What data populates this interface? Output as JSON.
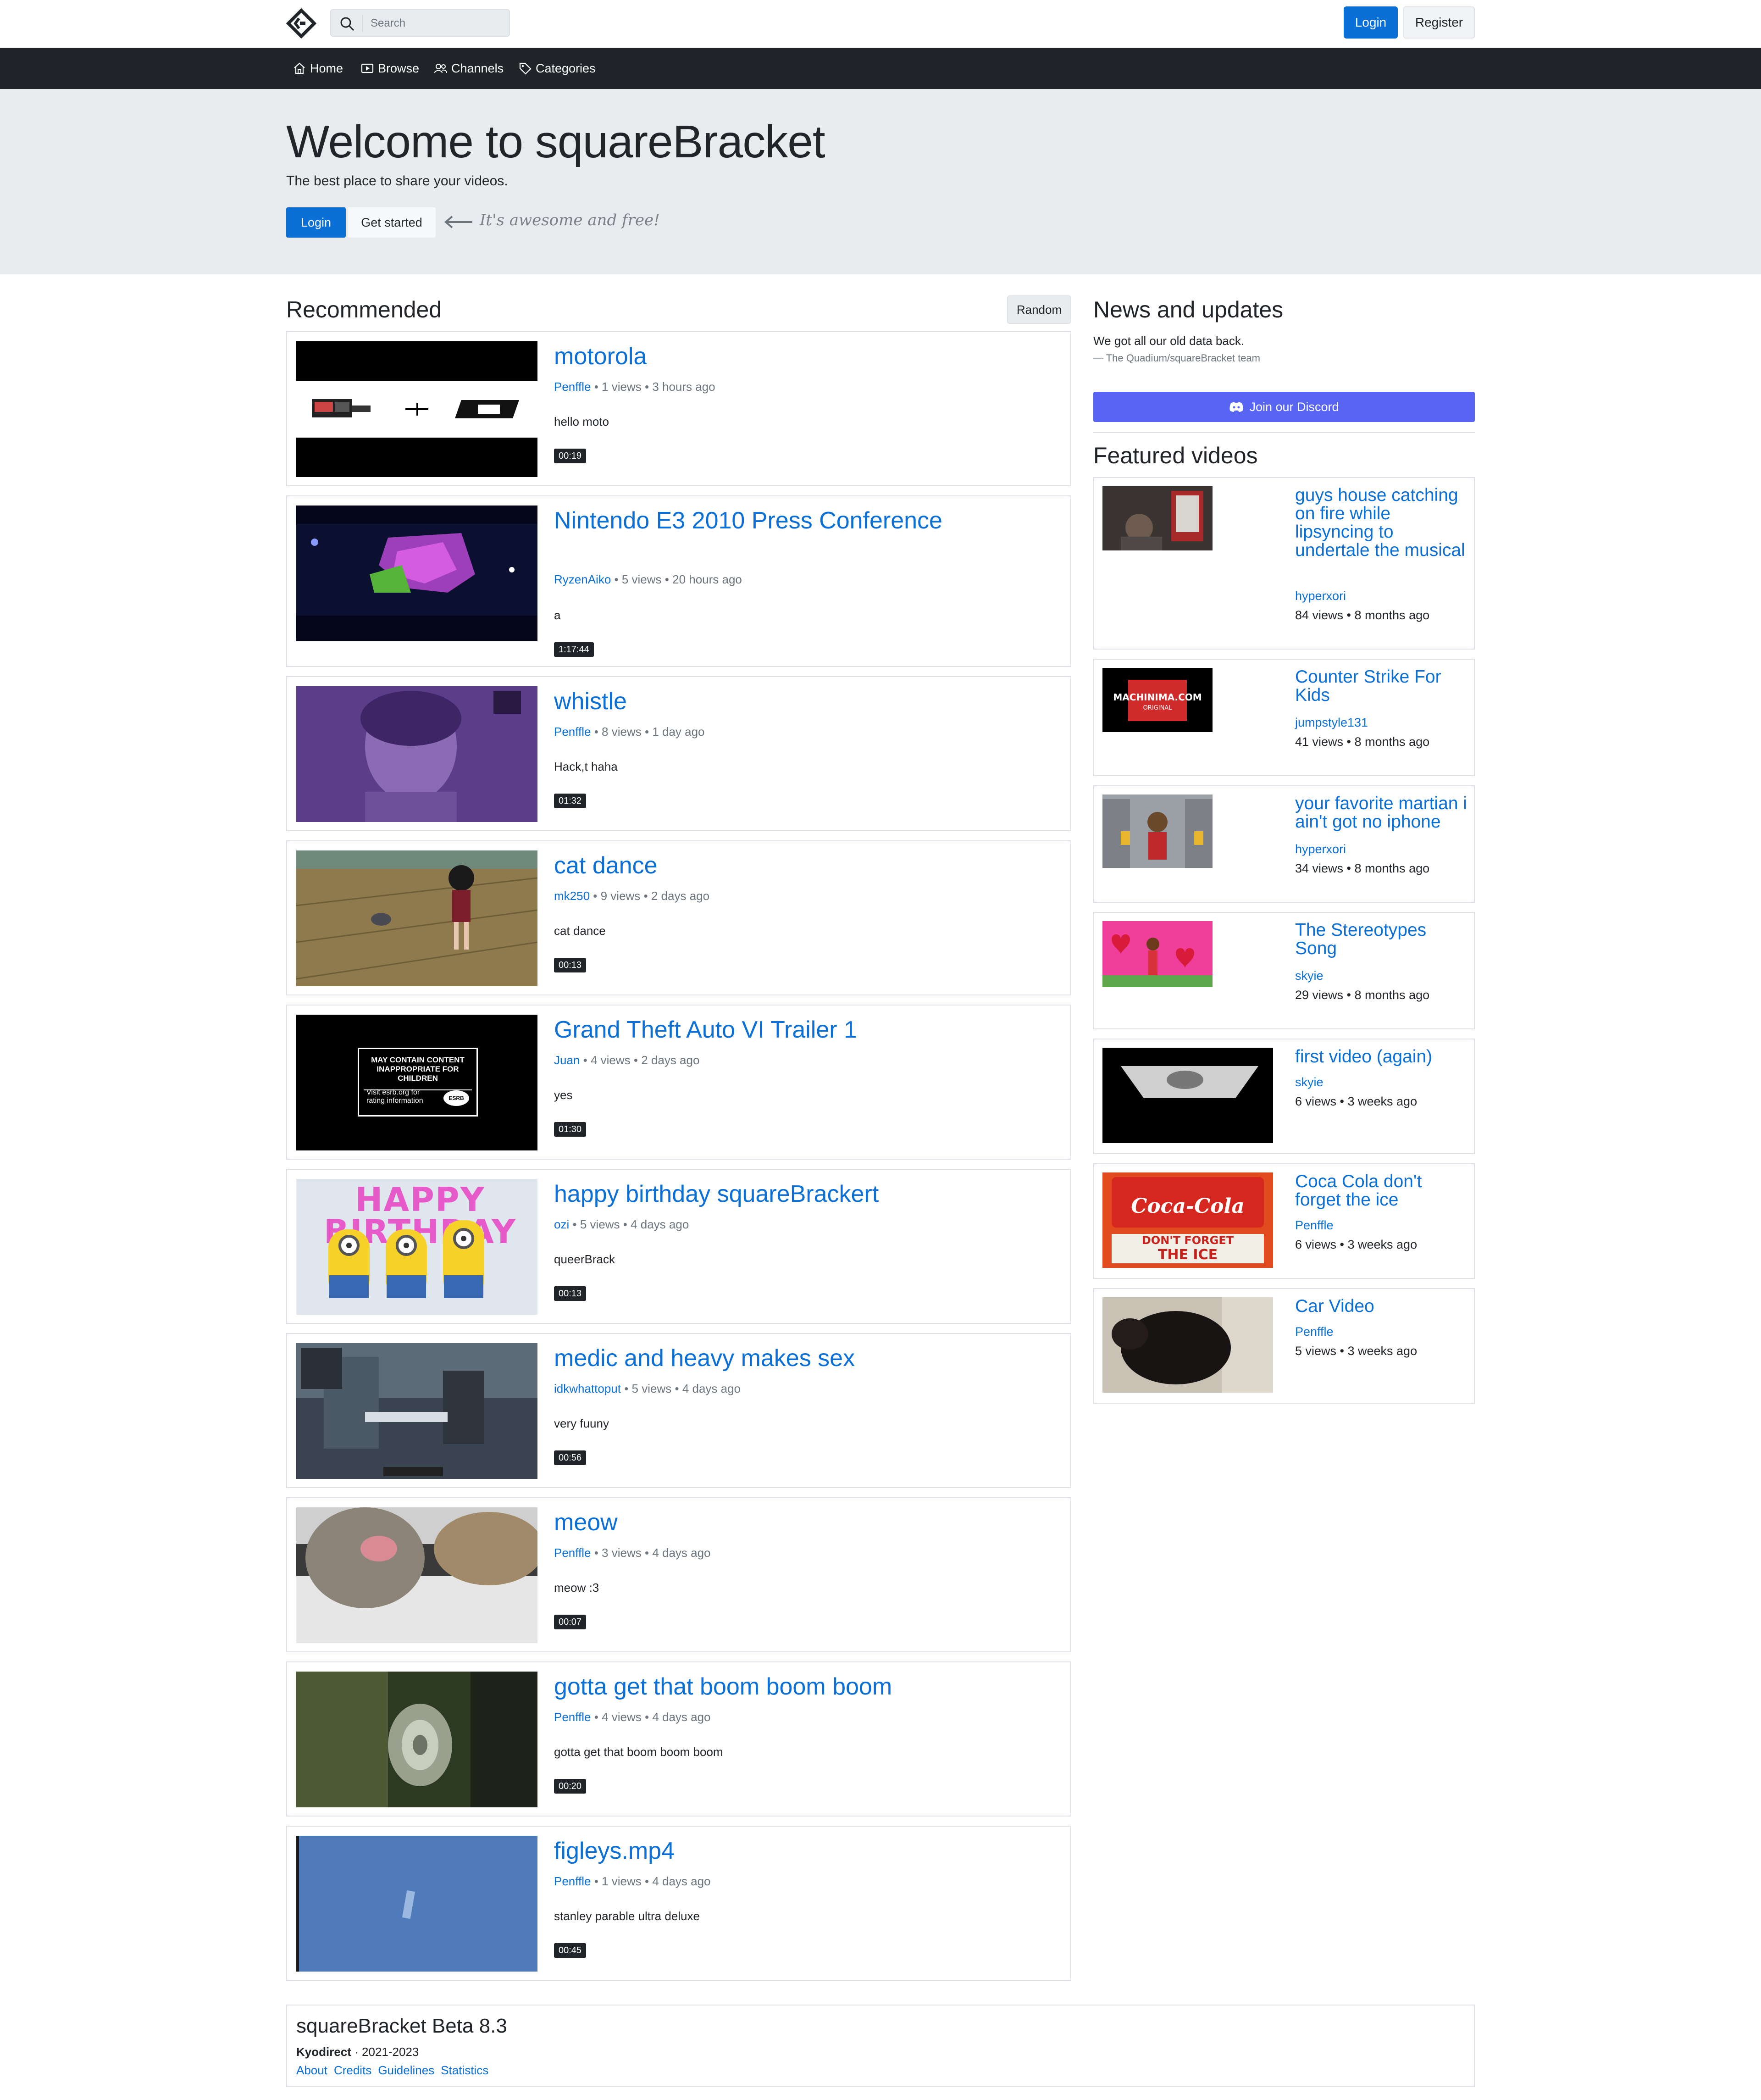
{
  "header": {
    "search_placeholder": "Search",
    "login_label": "Login",
    "register_label": "Register"
  },
  "nav": {
    "items": [
      {
        "label": "Home",
        "icon": "home-icon"
      },
      {
        "label": "Browse",
        "icon": "play-icon"
      },
      {
        "label": "Channels",
        "icon": "users-icon"
      },
      {
        "label": "Categories",
        "icon": "tag-icon"
      }
    ]
  },
  "hero": {
    "title": "Welcome to squareBracket",
    "lead": "The best place to share your videos.",
    "login_label": "Login",
    "start_label": "Get started",
    "tagline": "It's awesome and free!"
  },
  "recommended": {
    "title": "Recommended",
    "random_label": "Random",
    "videos": [
      {
        "title": "motorola",
        "author": "Penffle",
        "views": "1 views",
        "ago": "3 hours ago",
        "desc": "hello moto",
        "duration": "00:19"
      },
      {
        "title": "Nintendo E3 2010 Press Conference",
        "author": "RyzenAiko",
        "views": "5 views",
        "ago": "20 hours ago",
        "desc": "a",
        "duration": "1:17:44"
      },
      {
        "title": "whistle",
        "author": "Penffle",
        "views": "8 views",
        "ago": "1 day ago",
        "desc": "Hack,t haha",
        "duration": "01:32"
      },
      {
        "title": "cat dance",
        "author": "mk250",
        "views": "9 views",
        "ago": "2 days ago",
        "desc": "cat dance",
        "duration": "00:13"
      },
      {
        "title": "Grand Theft Auto VI Trailer 1",
        "author": "Juan",
        "views": "4 views",
        "ago": "2 days ago",
        "desc": "yes",
        "duration": "01:30"
      },
      {
        "title": "happy birthday squareBrackert",
        "author": "ozi",
        "views": "5 views",
        "ago": "4 days ago",
        "desc": "queerBrack",
        "duration": "00:13"
      },
      {
        "title": "medic and heavy makes sex",
        "author": "idkwhattoput",
        "views": "5 views",
        "ago": "4 days ago",
        "desc": "very fuuny",
        "duration": "00:56"
      },
      {
        "title": "meow",
        "author": "Penffle",
        "views": "3 views",
        "ago": "4 days ago",
        "desc": "meow :3",
        "duration": "00:07"
      },
      {
        "title": "gotta get that boom boom boom",
        "author": "Penffle",
        "views": "4 views",
        "ago": "4 days ago",
        "desc": "gotta get that boom boom boom",
        "duration": "00:20"
      },
      {
        "title": "figleys.mp4",
        "author": "Penffle",
        "views": "1 views",
        "ago": "4 days ago",
        "desc": "stanley parable ultra deluxe",
        "duration": "00:45"
      }
    ],
    "thumb_texts": {
      "esrb_line1": "MAY CONTAIN CONTENT",
      "esrb_line2": "INAPPROPRIATE FOR CHILDREN",
      "esrb_line3": "Visit esrb.org for",
      "esrb_line4": "rating information",
      "esrb_logo": "ESRB",
      "birthday": "HAPPY BIRTHDAY"
    }
  },
  "news": {
    "title": "News and updates",
    "text": "We got all our old data back.",
    "signature": "— The Quadium/squareBracket team",
    "discord_label": "Join our Discord"
  },
  "featured": {
    "title": "Featured videos",
    "videos": [
      {
        "title": "guys house catching on fire while lipsyncing to undertale the musical",
        "author": "hyperxori",
        "meta": "84 views • 8 months ago"
      },
      {
        "title": "Counter Strike For Kids",
        "author": "jumpstyle131",
        "meta": "41 views • 8 months ago"
      },
      {
        "title": "your favorite martian i ain't got no iphone",
        "author": "hyperxori",
        "meta": "34 views • 8 months ago"
      },
      {
        "title": "The Stereotypes Song",
        "author": "skyie",
        "meta": "29 views • 8 months ago"
      },
      {
        "title": "first video (again)",
        "author": "skyie",
        "meta": "6 views • 3 weeks ago"
      },
      {
        "title": "Coca Cola don't forget the ice",
        "author": "Penffle",
        "meta": "6 views • 3 weeks ago"
      },
      {
        "title": "Car Video",
        "author": "Penffle",
        "meta": "5 views • 3 weeks ago"
      }
    ],
    "thumb_texts": {
      "machinima": "MACHINIMA.COM",
      "machinima_sub": "ORIGINAL",
      "cocacola": "Coca-Cola",
      "dont_forget": "DON'T FORGET",
      "the_ice": "THE ICE"
    }
  },
  "footer": {
    "title": "squareBracket Beta 8.3",
    "author": "Kyodirect",
    "years": " · 2021-2023",
    "links": [
      "About",
      "Credits",
      "Guidelines",
      "Statistics"
    ]
  },
  "colors": {
    "accent": "#0a6fd6",
    "navbar": "#212529",
    "hero_bg": "#e9ecef",
    "discord": "#5865f2"
  }
}
